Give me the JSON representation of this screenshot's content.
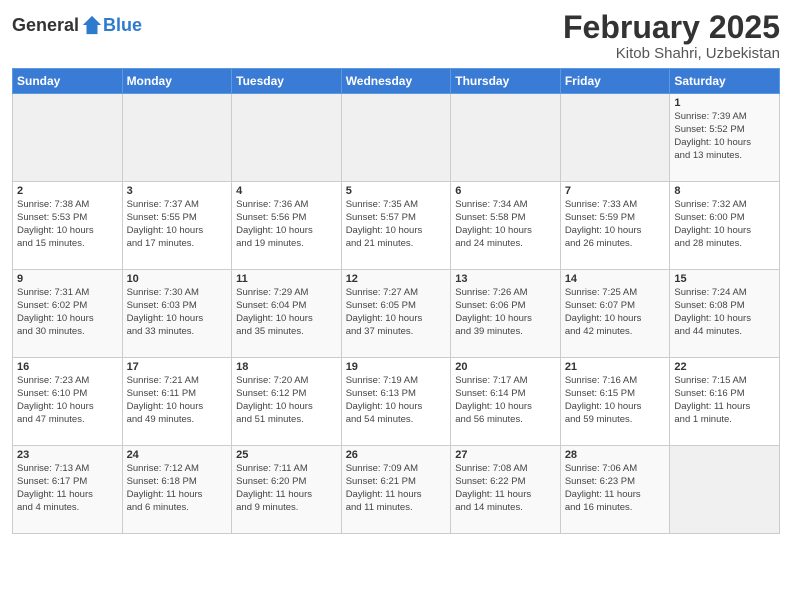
{
  "header": {
    "logo_general": "General",
    "logo_blue": "Blue",
    "title": "February 2025",
    "subtitle": "Kitob Shahri, Uzbekistan"
  },
  "weekdays": [
    "Sunday",
    "Monday",
    "Tuesday",
    "Wednesday",
    "Thursday",
    "Friday",
    "Saturday"
  ],
  "weeks": [
    [
      {
        "day": "",
        "info": ""
      },
      {
        "day": "",
        "info": ""
      },
      {
        "day": "",
        "info": ""
      },
      {
        "day": "",
        "info": ""
      },
      {
        "day": "",
        "info": ""
      },
      {
        "day": "",
        "info": ""
      },
      {
        "day": "1",
        "info": "Sunrise: 7:39 AM\nSunset: 5:52 PM\nDaylight: 10 hours\nand 13 minutes."
      }
    ],
    [
      {
        "day": "2",
        "info": "Sunrise: 7:38 AM\nSunset: 5:53 PM\nDaylight: 10 hours\nand 15 minutes."
      },
      {
        "day": "3",
        "info": "Sunrise: 7:37 AM\nSunset: 5:55 PM\nDaylight: 10 hours\nand 17 minutes."
      },
      {
        "day": "4",
        "info": "Sunrise: 7:36 AM\nSunset: 5:56 PM\nDaylight: 10 hours\nand 19 minutes."
      },
      {
        "day": "5",
        "info": "Sunrise: 7:35 AM\nSunset: 5:57 PM\nDaylight: 10 hours\nand 21 minutes."
      },
      {
        "day": "6",
        "info": "Sunrise: 7:34 AM\nSunset: 5:58 PM\nDaylight: 10 hours\nand 24 minutes."
      },
      {
        "day": "7",
        "info": "Sunrise: 7:33 AM\nSunset: 5:59 PM\nDaylight: 10 hours\nand 26 minutes."
      },
      {
        "day": "8",
        "info": "Sunrise: 7:32 AM\nSunset: 6:00 PM\nDaylight: 10 hours\nand 28 minutes."
      }
    ],
    [
      {
        "day": "9",
        "info": "Sunrise: 7:31 AM\nSunset: 6:02 PM\nDaylight: 10 hours\nand 30 minutes."
      },
      {
        "day": "10",
        "info": "Sunrise: 7:30 AM\nSunset: 6:03 PM\nDaylight: 10 hours\nand 33 minutes."
      },
      {
        "day": "11",
        "info": "Sunrise: 7:29 AM\nSunset: 6:04 PM\nDaylight: 10 hours\nand 35 minutes."
      },
      {
        "day": "12",
        "info": "Sunrise: 7:27 AM\nSunset: 6:05 PM\nDaylight: 10 hours\nand 37 minutes."
      },
      {
        "day": "13",
        "info": "Sunrise: 7:26 AM\nSunset: 6:06 PM\nDaylight: 10 hours\nand 39 minutes."
      },
      {
        "day": "14",
        "info": "Sunrise: 7:25 AM\nSunset: 6:07 PM\nDaylight: 10 hours\nand 42 minutes."
      },
      {
        "day": "15",
        "info": "Sunrise: 7:24 AM\nSunset: 6:08 PM\nDaylight: 10 hours\nand 44 minutes."
      }
    ],
    [
      {
        "day": "16",
        "info": "Sunrise: 7:23 AM\nSunset: 6:10 PM\nDaylight: 10 hours\nand 47 minutes."
      },
      {
        "day": "17",
        "info": "Sunrise: 7:21 AM\nSunset: 6:11 PM\nDaylight: 10 hours\nand 49 minutes."
      },
      {
        "day": "18",
        "info": "Sunrise: 7:20 AM\nSunset: 6:12 PM\nDaylight: 10 hours\nand 51 minutes."
      },
      {
        "day": "19",
        "info": "Sunrise: 7:19 AM\nSunset: 6:13 PM\nDaylight: 10 hours\nand 54 minutes."
      },
      {
        "day": "20",
        "info": "Sunrise: 7:17 AM\nSunset: 6:14 PM\nDaylight: 10 hours\nand 56 minutes."
      },
      {
        "day": "21",
        "info": "Sunrise: 7:16 AM\nSunset: 6:15 PM\nDaylight: 10 hours\nand 59 minutes."
      },
      {
        "day": "22",
        "info": "Sunrise: 7:15 AM\nSunset: 6:16 PM\nDaylight: 11 hours\nand 1 minute."
      }
    ],
    [
      {
        "day": "23",
        "info": "Sunrise: 7:13 AM\nSunset: 6:17 PM\nDaylight: 11 hours\nand 4 minutes."
      },
      {
        "day": "24",
        "info": "Sunrise: 7:12 AM\nSunset: 6:18 PM\nDaylight: 11 hours\nand 6 minutes."
      },
      {
        "day": "25",
        "info": "Sunrise: 7:11 AM\nSunset: 6:20 PM\nDaylight: 11 hours\nand 9 minutes."
      },
      {
        "day": "26",
        "info": "Sunrise: 7:09 AM\nSunset: 6:21 PM\nDaylight: 11 hours\nand 11 minutes."
      },
      {
        "day": "27",
        "info": "Sunrise: 7:08 AM\nSunset: 6:22 PM\nDaylight: 11 hours\nand 14 minutes."
      },
      {
        "day": "28",
        "info": "Sunrise: 7:06 AM\nSunset: 6:23 PM\nDaylight: 11 hours\nand 16 minutes."
      },
      {
        "day": "",
        "info": ""
      }
    ]
  ]
}
